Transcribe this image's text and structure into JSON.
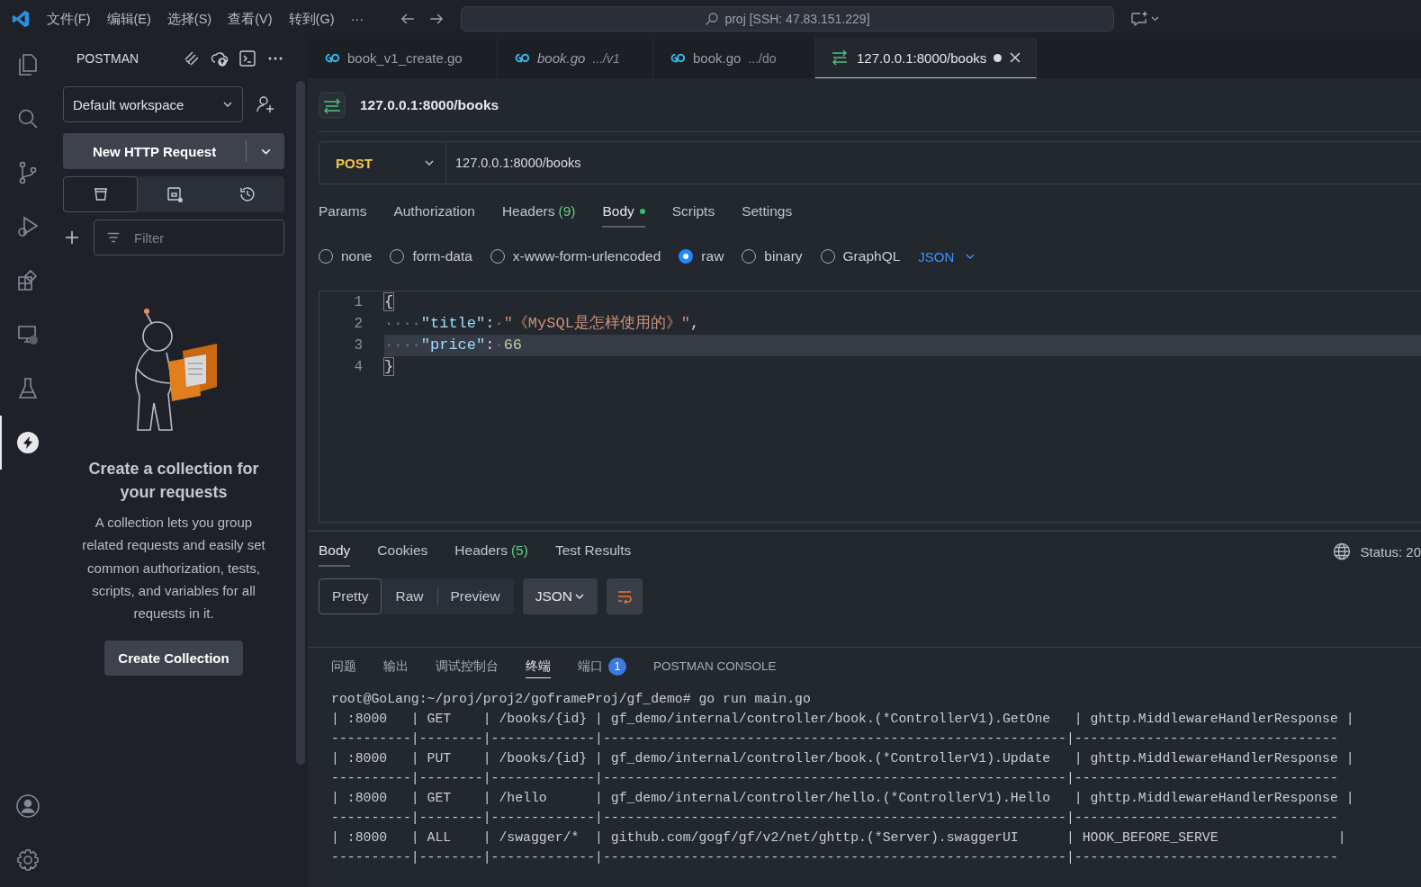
{
  "title_bar": {
    "menus": [
      "文件(F)",
      "编辑(E)",
      "选择(S)",
      "查看(V)",
      "转到(G)"
    ],
    "more": "···",
    "search": "proj [SSH: 47.83.151.229]"
  },
  "activity_bar": {
    "items": [
      {
        "kind": "explorer",
        "selected": false
      },
      {
        "kind": "search",
        "selected": false
      },
      {
        "kind": "source-control",
        "selected": false
      },
      {
        "kind": "run-debug",
        "selected": false
      },
      {
        "kind": "extensions",
        "selected": false
      },
      {
        "kind": "remote",
        "selected": false
      },
      {
        "kind": "testing",
        "selected": false
      },
      {
        "kind": "postman",
        "selected": true
      }
    ],
    "bottom": [
      {
        "kind": "account"
      },
      {
        "kind": "settings"
      }
    ]
  },
  "sidebar": {
    "title": "POSTMAN",
    "workspace": "Default workspace",
    "new_request": "New HTTP Request",
    "view_tabs": [
      {
        "kind": "collections",
        "selected": true
      },
      {
        "kind": "environments",
        "selected": false
      },
      {
        "kind": "history",
        "selected": false
      }
    ],
    "filter": {
      "placeholder": "Filter"
    },
    "empty_title": "Create a collection for your requests",
    "empty_text": "A collection lets you group related requests and easily set common authorization, tests, scripts, and variables for all requests in it.",
    "create_button": "Create Collection"
  },
  "tabs": [
    {
      "kind": "go",
      "name": "book_v1_create.go",
      "preview": false,
      "modified": false,
      "selected": false
    },
    {
      "kind": "go",
      "name": "book.go",
      "path": ".../v1",
      "preview": true,
      "modified": false,
      "selected": false
    },
    {
      "kind": "go",
      "name": "book.go",
      "path": ".../do",
      "preview": false,
      "modified": false,
      "selected": false
    },
    {
      "kind": "http",
      "name": "127.0.0.1:8000/books",
      "preview": false,
      "modified": true,
      "selected": true
    }
  ],
  "request": {
    "title": "127.0.0.1:8000/books",
    "method": "POST",
    "url": "127.0.0.1:8000/books",
    "tabs": [
      {
        "label": "Params",
        "dot": false,
        "selected": false
      },
      {
        "label": "Authorization",
        "dot": false,
        "selected": false
      },
      {
        "label": "Headers",
        "count": "(9)",
        "dot": false,
        "selected": false
      },
      {
        "label": "Body",
        "dot": true,
        "selected": true
      },
      {
        "label": "Scripts",
        "dot": false,
        "selected": false
      },
      {
        "label": "Settings",
        "dot": false,
        "selected": false
      }
    ],
    "body_types": [
      {
        "label": "none",
        "selected": false
      },
      {
        "label": "form-data",
        "selected": false
      },
      {
        "label": "x-www-form-urlencoded",
        "selected": false
      },
      {
        "label": "raw",
        "selected": true
      },
      {
        "label": "binary",
        "selected": false
      },
      {
        "label": "GraphQL",
        "selected": false
      }
    ],
    "body_format": "JSON",
    "code": [
      {
        "number": "1",
        "current": false,
        "tokens": [
          {
            "kind": "bracket",
            "text": "{"
          }
        ]
      },
      {
        "number": "2",
        "current": false,
        "tokens": [
          {
            "kind": "ws",
            "text": "····"
          },
          {
            "kind": "key",
            "text": "\"title\""
          },
          {
            "kind": "punct",
            "text": ":"
          },
          {
            "kind": "ws",
            "text": "·"
          },
          {
            "kind": "string",
            "text": "\"《MySQL是怎样使用的》\""
          },
          {
            "kind": "punct",
            "text": ","
          }
        ]
      },
      {
        "number": "3",
        "current": true,
        "tokens": [
          {
            "kind": "ws",
            "text": "····"
          },
          {
            "kind": "key",
            "text": "\"price\""
          },
          {
            "kind": "punct",
            "text": ":"
          },
          {
            "kind": "ws",
            "text": "·"
          },
          {
            "kind": "number",
            "text": "66"
          }
        ]
      },
      {
        "number": "4",
        "current": false,
        "tokens": [
          {
            "kind": "bracket",
            "text": "}"
          }
        ]
      }
    ]
  },
  "response": {
    "tabs": [
      {
        "label": "Body",
        "selected": true
      },
      {
        "label": "Cookies",
        "selected": false
      },
      {
        "label": "Headers",
        "count": "(5)",
        "selected": false
      },
      {
        "label": "Test Results",
        "selected": false
      }
    ],
    "status": "Status: 20",
    "views": [
      {
        "label": "Pretty",
        "selected": true
      },
      {
        "label": "Raw",
        "selected": false
      },
      {
        "label": "Preview",
        "selected": false
      }
    ],
    "format": "JSON"
  },
  "panel": {
    "tabs": [
      {
        "label": "问题",
        "selected": false
      },
      {
        "label": "输出",
        "selected": false
      },
      {
        "label": "调试控制台",
        "selected": false
      },
      {
        "label": "终端",
        "selected": true
      },
      {
        "label": "端口",
        "badge": "1",
        "selected": false
      },
      {
        "label": "POSTMAN CONSOLE",
        "selected": false
      }
    ],
    "terminal": [
      "root@GoLang:~/proj/proj2/goframeProj/gf_demo# go run main.go",
      "| :8000   | GET    | /books/{id} | gf_demo/internal/controller/book.(*ControllerV1).GetOne   | ghttp.MiddlewareHandlerResponse |",
      "----------|--------|-------------|----------------------------------------------------------|---------------------------------",
      "| :8000   | PUT    | /books/{id} | gf_demo/internal/controller/book.(*ControllerV1).Update   | ghttp.MiddlewareHandlerResponse |",
      "----------|--------|-------------|----------------------------------------------------------|---------------------------------",
      "| :8000   | GET    | /hello      | gf_demo/internal/controller/hello.(*ControllerV1).Hello   | ghttp.MiddlewareHandlerResponse |",
      "----------|--------|-------------|----------------------------------------------------------|---------------------------------",
      "| :8000   | ALL    | /swagger/*  | github.com/gogf/gf/v2/net/ghttp.(*Server).swaggerUI      | HOOK_BEFORE_SERVE               |",
      "----------|--------|-------------|----------------------------------------------------------|---------------------------------"
    ]
  }
}
